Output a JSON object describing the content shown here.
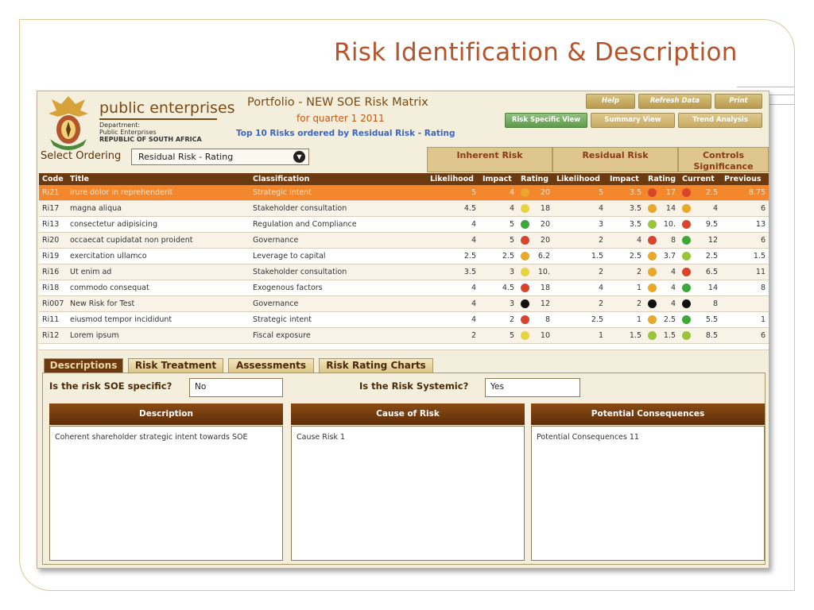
{
  "slide": {
    "title": "Risk Identification & Description"
  },
  "header": {
    "brand": "public enterprises",
    "dept_line1": "Department:",
    "dept_line2": "Public Enterprises",
    "dept_line3": "REPUBLIC OF SOUTH AFRICA",
    "portfolio": "Portfolio - NEW SOE Risk Matrix",
    "quarter": "for quarter 1 2011",
    "top10": "Top 10 Risks ordered by Residual Risk - Rating"
  },
  "buttons": {
    "help": "Help",
    "refresh": "Refresh Data",
    "print": "Print",
    "risk_specific": "Risk Specific View",
    "summary": "Summary View",
    "trend": "Trend Analysis"
  },
  "ordering": {
    "label": "Select Ordering",
    "value": "Residual Risk - Rating"
  },
  "groups": {
    "inherent": "Inherent Risk",
    "residual": "Residual Risk",
    "controls": "Controls Significance"
  },
  "columns": {
    "code": "Code",
    "title": "Title",
    "classification": "Classification",
    "i_likelihood": "Likelihood",
    "i_impact": "Impact",
    "i_rating": "Rating",
    "r_likelihood": "Likelihood",
    "r_impact": "Impact",
    "r_rating": "Rating",
    "current": "Current",
    "previous": "Previous"
  },
  "rows": [
    {
      "code": "Ri21",
      "title": "irure dolor in reprehenderit",
      "classification": "Strategic intent",
      "il": "5",
      "ii": "4",
      "ir": "20",
      "ir_c": "#e8a82a",
      "rl": "5",
      "ri": "3.5",
      "rr": "17",
      "rr_c": "#d8452c",
      "cur": "2.5",
      "cur_c": "#d8452c",
      "prev": "8.75"
    },
    {
      "code": "Ri17",
      "title": "magna aliqua",
      "classification": "Stakeholder consultation",
      "il": "4.5",
      "ii": "4",
      "ir": "18",
      "ir_c": "#e8d43a",
      "rl": "4",
      "ri": "3.5",
      "rr": "14",
      "rr_c": "#e8a82a",
      "cur": "4",
      "cur_c": "#e8a82a",
      "prev": "6"
    },
    {
      "code": "Ri13",
      "title": "consectetur adipisicing",
      "classification": "Regulation and Compliance",
      "il": "4",
      "ii": "5",
      "ir": "20",
      "ir_c": "#3da73a",
      "rl": "3",
      "ri": "3.5",
      "rr": "10.",
      "rr_c": "#9ac43a",
      "cur": "9.5",
      "cur_c": "#d8452c",
      "prev": "13"
    },
    {
      "code": "Ri20",
      "title": "occaecat cupidatat non proident",
      "classification": "Governance",
      "il": "4",
      "ii": "5",
      "ir": "20",
      "ir_c": "#d8452c",
      "rl": "2",
      "ri": "4",
      "rr": "8",
      "rr_c": "#d8452c",
      "cur": "12",
      "cur_c": "#3da73a",
      "prev": "6"
    },
    {
      "code": "Ri19",
      "title": "exercitation ullamco",
      "classification": "Leverage to capital",
      "il": "2.5",
      "ii": "2.5",
      "ir": "6.2",
      "ir_c": "#e8a82a",
      "rl": "1.5",
      "ri": "2.5",
      "rr": "3.7",
      "rr_c": "#e8a82a",
      "cur": "2.5",
      "cur_c": "#9ac43a",
      "prev": "1.5"
    },
    {
      "code": "Ri16",
      "title": "Ut enim ad",
      "classification": "Stakeholder consultation",
      "il": "3.5",
      "ii": "3",
      "ir": "10.",
      "ir_c": "#e8d43a",
      "rl": "2",
      "ri": "2",
      "rr": "4",
      "rr_c": "#e8a82a",
      "cur": "6.5",
      "cur_c": "#d8452c",
      "prev": "11"
    },
    {
      "code": "Ri18",
      "title": "commodo consequat",
      "classification": "Exogenous factors",
      "il": "4",
      "ii": "4.5",
      "ir": "18",
      "ir_c": "#d8452c",
      "rl": "4",
      "ri": "1",
      "rr": "4",
      "rr_c": "#e8a82a",
      "cur": "14",
      "cur_c": "#3da73a",
      "prev": "8"
    },
    {
      "code": "Ri007",
      "title": "New Risk for Test",
      "classification": "Governance",
      "il": "4",
      "ii": "3",
      "ir": "12",
      "ir_c": "#111111",
      "rl": "2",
      "ri": "2",
      "rr": "4",
      "rr_c": "#111111",
      "cur": "8",
      "cur_c": "#111111",
      "prev": ""
    },
    {
      "code": "Ri11",
      "title": "eiusmod tempor incididunt",
      "classification": "Strategic intent",
      "il": "4",
      "ii": "2",
      "ir": "8",
      "ir_c": "#d8452c",
      "rl": "2.5",
      "ri": "1",
      "rr": "2.5",
      "rr_c": "#e8a82a",
      "cur": "5.5",
      "cur_c": "#3da73a",
      "prev": "1"
    },
    {
      "code": "Ri12",
      "title": "Lorem ipsum",
      "classification": "Fiscal exposure",
      "il": "2",
      "ii": "5",
      "ir": "10",
      "ir_c": "#e8d43a",
      "rl": "1",
      "ri": "1.5",
      "rr": "1.5",
      "rr_c": "#9ac43a",
      "cur": "8.5",
      "cur_c": "#9ac43a",
      "prev": "6"
    }
  ],
  "tabs": [
    "Descriptions",
    "Risk Treatment",
    "Assessments",
    "Risk Rating Charts"
  ],
  "questions": {
    "soe_label": "Is the risk SOE specific?",
    "soe_value": "No",
    "systemic_label": "Is the Risk Systemic?",
    "systemic_value": "Yes"
  },
  "boxes": {
    "desc_title": "Description",
    "desc_text": "Coherent shareholder strategic intent towards SOE",
    "cause_title": "Cause of Risk",
    "cause_text": "Cause Risk 1",
    "cons_title": "Potential Consequences",
    "cons_text": "Potential Consequences 11"
  }
}
